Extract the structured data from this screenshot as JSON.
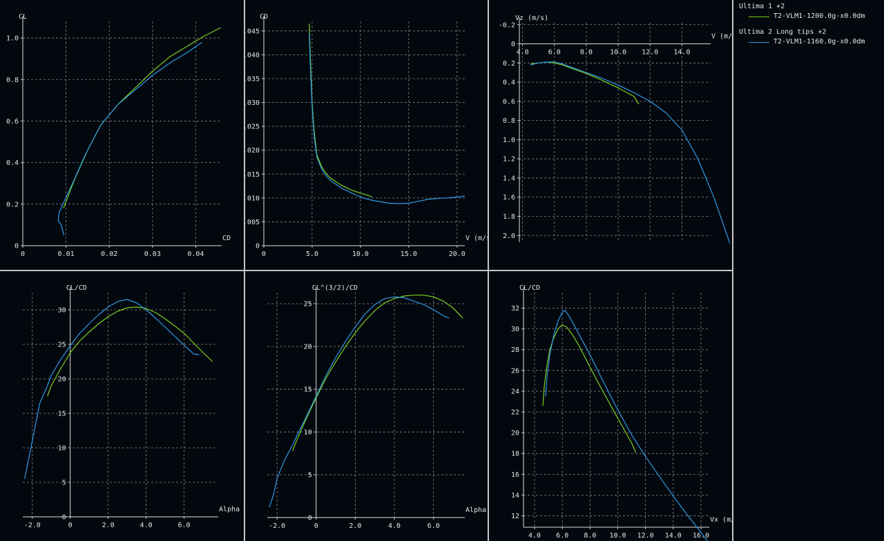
{
  "legend": [
    {
      "name": "Ultima 1 +2",
      "label": "T2-VLM1-1200.0g-x0.0dm",
      "color": "#7ed321"
    },
    {
      "name": "Ultima 2 Long tips +2",
      "label": "T2-VLM1-1160.0g-x0.0dm",
      "color": "#2f9be8"
    }
  ],
  "chart_data": [
    {
      "type": "line",
      "ylabel": "CL",
      "xlabel": "CD",
      "xlim": [
        0,
        0.046
      ],
      "ylim": [
        0,
        1.08
      ],
      "xticks": [
        0,
        0.01,
        0.02,
        0.03,
        0.04
      ],
      "xtick_labels": [
        "0",
        "0.01",
        "0.02",
        "0.03",
        "0.04"
      ],
      "yticks": [
        0,
        0.2,
        0.4,
        0.6,
        0.8,
        1.0
      ],
      "ytick_labels": [
        "0",
        "0.2",
        "0.4",
        "0.6",
        "0.8",
        "1.0"
      ],
      "grid": true,
      "series": [
        {
          "name": "T2-VLM1-1200.0g-x0.0dm",
          "color": "#7ed321",
          "x": [
            0.0094,
            0.012,
            0.015,
            0.018,
            0.022,
            0.026,
            0.03,
            0.034,
            0.038,
            0.042,
            0.0458
          ],
          "y": [
            0.18,
            0.32,
            0.46,
            0.58,
            0.68,
            0.76,
            0.84,
            0.91,
            0.96,
            1.01,
            1.05
          ]
        },
        {
          "name": "T2-VLM1-1160.0g-x0.0dm",
          "color": "#2f9be8",
          "x": [
            0.0095,
            0.0089,
            0.0082,
            0.0084,
            0.0095,
            0.0115,
            0.0145,
            0.018,
            0.022,
            0.026,
            0.03,
            0.034,
            0.038,
            0.0415
          ],
          "y": [
            0.05,
            0.1,
            0.12,
            0.16,
            0.21,
            0.3,
            0.44,
            0.58,
            0.68,
            0.75,
            0.82,
            0.88,
            0.93,
            0.98
          ]
        }
      ]
    },
    {
      "type": "line",
      "ylabel": "CD",
      "xlabel": "V (m/s)",
      "xlim": [
        0,
        20.8
      ],
      "ylim": [
        0,
        0.047
      ],
      "xticks": [
        0,
        5,
        10,
        15,
        20
      ],
      "xtick_labels": [
        "0",
        "5.0",
        "10.0",
        "15.0",
        "20.0"
      ],
      "yticks": [
        0,
        0.005,
        0.01,
        0.015,
        0.02,
        0.025,
        0.03,
        0.035,
        0.04,
        0.045
      ],
      "ytick_labels": [
        "0",
        ".005",
        ".010",
        ".015",
        ".020",
        ".025",
        ".030",
        ".035",
        ".040",
        ".045"
      ],
      "grid": true,
      "series": [
        {
          "name": "T2-VLM1-1200.0g-x0.0dm",
          "color": "#7ed321",
          "x": [
            4.7,
            4.8,
            5.0,
            5.2,
            5.5,
            6.0,
            6.5,
            7.0,
            8.0,
            9.0,
            10.0,
            11.0,
            11.2
          ],
          "y": [
            0.0465,
            0.04,
            0.03,
            0.024,
            0.019,
            0.0165,
            0.015,
            0.014,
            0.0127,
            0.0117,
            0.011,
            0.0104,
            0.0102
          ]
        },
        {
          "name": "T2-VLM1-1160.0g-x0.0dm",
          "color": "#2f9be8",
          "x": [
            4.7,
            4.8,
            5.0,
            5.2,
            5.5,
            6.0,
            6.5,
            7.0,
            8.0,
            9.0,
            10.0,
            11.0,
            12.0,
            13.0,
            14.0,
            15.0,
            16.0,
            17.0,
            18.0,
            19.0,
            20.0,
            20.8
          ],
          "y": [
            0.0445,
            0.038,
            0.029,
            0.023,
            0.0185,
            0.016,
            0.0145,
            0.0135,
            0.0121,
            0.0111,
            0.0102,
            0.0096,
            0.0092,
            0.0089,
            0.0088,
            0.0089,
            0.0093,
            0.0097,
            0.0099,
            0.01,
            0.0102,
            0.0104
          ]
        }
      ]
    },
    {
      "type": "line",
      "ylabel": "Vz (m/s)",
      "xlabel": "V (m/s)",
      "xlim": [
        3.8,
        15.8
      ],
      "ylim": [
        -0.22,
        2.07
      ],
      "y_inverted": true,
      "xticks": [
        4,
        6,
        8,
        10,
        12,
        14
      ],
      "xtick_labels": [
        "4.0",
        "6.0",
        "8.0",
        "10.0",
        "12.0",
        "14.0"
      ],
      "yticks": [
        -0.2,
        0,
        0.2,
        0.4,
        0.6,
        0.8,
        1.0,
        1.2,
        1.4,
        1.6,
        1.8,
        2.0
      ],
      "ytick_labels": [
        "-0.2",
        "0",
        "0.2",
        "0.4",
        "0.6",
        "0.8",
        "1.0",
        "1.2",
        "1.4",
        "1.6",
        "1.8",
        "2.0"
      ],
      "grid": true,
      "series": [
        {
          "name": "T2-VLM1-1200.0g-x0.0dm",
          "color": "#7ed321",
          "x": [
            4.5,
            5.0,
            5.5,
            6.0,
            6.5,
            7.0,
            8.0,
            9.0,
            10.0,
            11.0,
            11.3
          ],
          "y": [
            0.21,
            0.2,
            0.19,
            0.2,
            0.22,
            0.25,
            0.31,
            0.38,
            0.46,
            0.55,
            0.63
          ]
        },
        {
          "name": "T2-VLM1-1160.0g-x0.0dm",
          "color": "#2f9be8",
          "x": [
            4.5,
            5.0,
            5.5,
            6.0,
            6.5,
            7.0,
            8.0,
            9.0,
            10.0,
            11.0,
            12.0,
            13.0,
            14.0,
            15.0,
            16.0,
            17.0
          ],
          "y": [
            0.22,
            0.2,
            0.19,
            0.19,
            0.21,
            0.24,
            0.3,
            0.36,
            0.43,
            0.51,
            0.6,
            0.72,
            0.9,
            1.2,
            1.6,
            2.08
          ]
        }
      ]
    },
    {
      "type": "line",
      "ylabel": "CL/CD",
      "xlabel": "Alpha",
      "xlim": [
        -2.5,
        7.8
      ],
      "ylim": [
        0,
        32.5
      ],
      "xticks": [
        -2,
        0,
        2,
        4,
        6
      ],
      "xtick_labels": [
        "-2.0",
        "0",
        "2.0",
        "4.0",
        "6.0"
      ],
      "yticks": [
        0,
        5,
        10,
        15,
        20,
        25,
        30
      ],
      "ytick_labels": [
        "0",
        "5",
        "10",
        "15",
        "20",
        "25",
        "30"
      ],
      "grid": true,
      "series": [
        {
          "name": "T2-VLM1-1200.0g-x0.0dm",
          "color": "#7ed321",
          "x": [
            -1.2,
            -1.0,
            -0.5,
            0,
            0.5,
            1.0,
            1.5,
            2.0,
            2.5,
            3.0,
            3.5,
            4.0,
            4.5,
            5.0,
            5.5,
            6.0,
            6.5,
            7.0,
            7.5
          ],
          "y": [
            17.5,
            19.0,
            21.5,
            23.8,
            25.5,
            26.8,
            28.0,
            29.0,
            29.8,
            30.3,
            30.4,
            30.2,
            29.6,
            28.7,
            27.7,
            26.6,
            25.2,
            23.8,
            22.5
          ]
        },
        {
          "name": "T2-VLM1-1160.0g-x0.0dm",
          "color": "#2f9be8",
          "x": [
            -2.4,
            -2.0,
            -1.6,
            -1.2,
            -1.0,
            -0.5,
            0,
            0.5,
            1.0,
            1.5,
            2.0,
            2.5,
            3.0,
            3.5,
            4.0,
            4.5,
            5.0,
            5.5,
            6.0,
            6.5,
            6.8
          ],
          "y": [
            5.5,
            11.0,
            16.5,
            19.0,
            20.5,
            22.8,
            24.8,
            26.6,
            28.0,
            29.3,
            30.4,
            31.2,
            31.5,
            31.0,
            30.0,
            28.8,
            27.5,
            26.2,
            24.9,
            23.6,
            23.5
          ]
        }
      ]
    },
    {
      "type": "line",
      "ylabel": "CL^(3/2)/CD",
      "xlabel": "Alpha",
      "xlim": [
        -2.5,
        7.6
      ],
      "ylim": [
        0,
        26.3
      ],
      "xticks": [
        -2,
        0,
        2,
        4,
        6
      ],
      "xtick_labels": [
        "-2.0",
        "0",
        "2.0",
        "4.0",
        "6.0"
      ],
      "yticks": [
        0,
        5,
        10,
        15,
        20,
        25
      ],
      "ytick_labels": [
        "0",
        "5",
        "10",
        "15",
        "20",
        "25"
      ],
      "grid": true,
      "series": [
        {
          "name": "T2-VLM1-1200.0g-x0.0dm",
          "color": "#7ed321",
          "x": [
            -1.2,
            -1.0,
            -0.5,
            0,
            0.5,
            1.0,
            1.5,
            2.0,
            2.5,
            3.0,
            3.5,
            4.0,
            4.5,
            5.0,
            5.5,
            6.0,
            6.5,
            7.0,
            7.5
          ],
          "y": [
            7.8,
            9.0,
            11.6,
            14.0,
            16.3,
            18.2,
            20.0,
            21.6,
            23.0,
            24.2,
            25.1,
            25.6,
            25.9,
            26.0,
            26.0,
            25.8,
            25.3,
            24.5,
            23.3
          ]
        },
        {
          "name": "T2-VLM1-1160.0g-x0.0dm",
          "color": "#2f9be8",
          "x": [
            -2.4,
            -2.2,
            -2.0,
            -1.6,
            -1.2,
            -1.0,
            -0.5,
            0,
            0.5,
            1.0,
            1.5,
            2.0,
            2.5,
            3.0,
            3.5,
            4.0,
            4.5,
            5.0,
            5.5,
            6.0,
            6.5,
            6.8
          ],
          "y": [
            1.2,
            2.5,
            4.6,
            6.8,
            8.5,
            9.5,
            11.8,
            14.2,
            16.6,
            18.7,
            20.6,
            22.3,
            23.8,
            24.9,
            25.6,
            25.8,
            25.7,
            25.3,
            24.9,
            24.3,
            23.6,
            23.3
          ]
        }
      ]
    },
    {
      "type": "line",
      "ylabel": "CL/CD",
      "xlabel": "Vx (m/s)",
      "xlim": [
        3.2,
        16.6
      ],
      "ylim": [
        10.9,
        33.5
      ],
      "xticks": [
        4,
        6,
        8,
        10,
        12,
        14,
        16
      ],
      "xtick_labels": [
        "4.0",
        "6.0",
        "8.0",
        "10.0",
        "12.0",
        "14.0",
        "16.0"
      ],
      "yticks": [
        12,
        14,
        16,
        18,
        20,
        22,
        24,
        26,
        28,
        30,
        32
      ],
      "ytick_labels": [
        "12",
        "14",
        "16",
        "18",
        "20",
        "22",
        "24",
        "26",
        "28",
        "30",
        "32"
      ],
      "grid": true,
      "series": [
        {
          "name": "T2-VLM1-1200.0g-x0.0dm",
          "color": "#7ed321",
          "x": [
            4.6,
            4.7,
            4.9,
            5.1,
            5.4,
            5.7,
            6.0,
            6.3,
            6.7,
            7.2,
            8.0,
            9.0,
            10.0,
            11.0,
            11.3
          ],
          "y": [
            22.6,
            24.5,
            26.5,
            28.0,
            29.2,
            30.0,
            30.4,
            30.2,
            29.5,
            28.4,
            26.3,
            23.8,
            21.4,
            19.0,
            18.1
          ]
        },
        {
          "name": "T2-VLM1-1160.0g-x0.0dm",
          "color": "#2f9be8",
          "x": [
            4.8,
            4.9,
            5.1,
            5.4,
            5.7,
            6.0,
            6.2,
            6.5,
            7.0,
            8.0,
            9.0,
            10.0,
            11.0,
            12.0,
            13.0,
            14.0,
            15.0,
            16.0,
            16.5
          ],
          "y": [
            23.5,
            25.5,
            27.5,
            29.5,
            30.8,
            31.6,
            31.8,
            31.2,
            30.0,
            27.5,
            24.8,
            22.2,
            19.8,
            17.7,
            15.8,
            13.9,
            12.1,
            10.4,
            9.5
          ]
        }
      ]
    }
  ]
}
